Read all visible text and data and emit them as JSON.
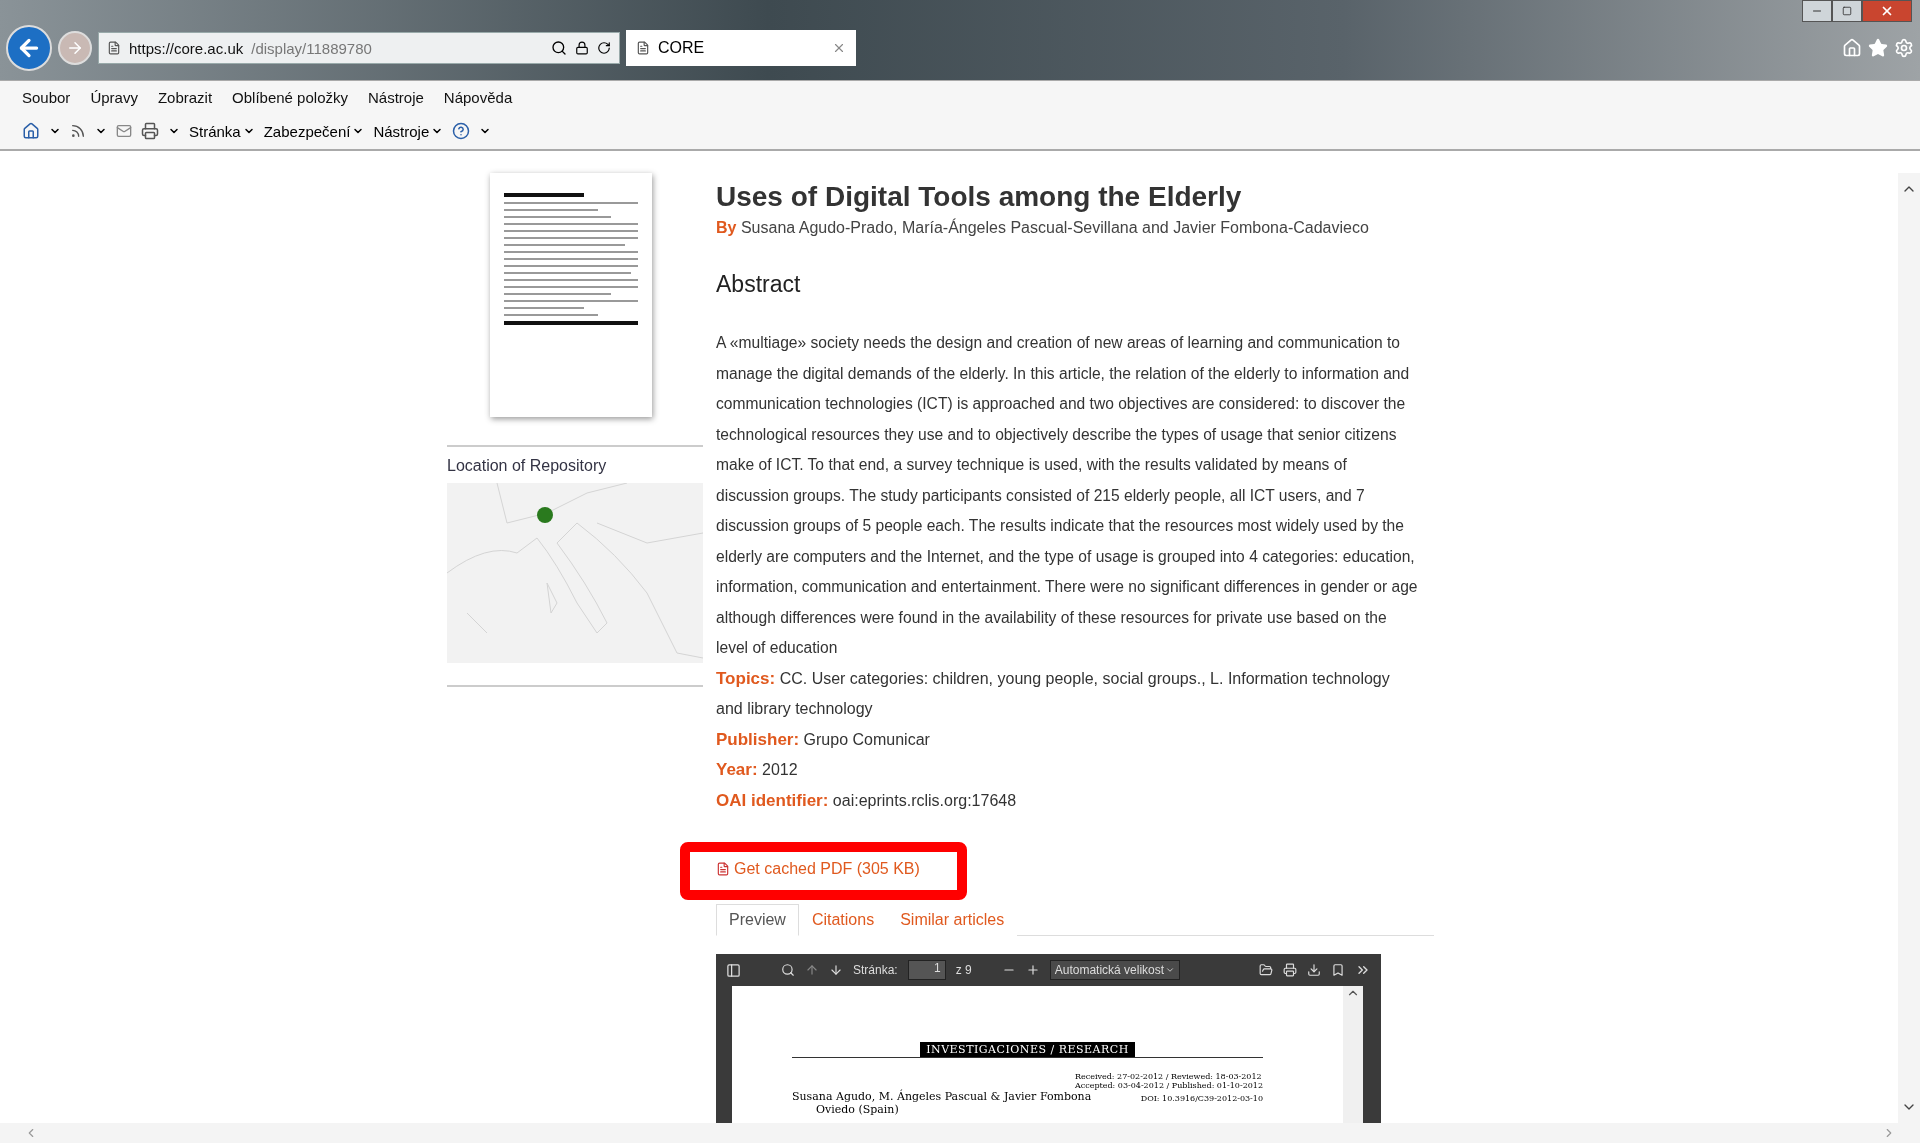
{
  "browser": {
    "address": {
      "host": "https://core.ac.uk",
      "path": "/display/11889780"
    },
    "tab": {
      "title": "CORE"
    },
    "menu": [
      "Soubor",
      "Úpravy",
      "Zobrazit",
      "Oblíbené položky",
      "Nástroje",
      "Nápověda"
    ],
    "toolbar": [
      "Stránka",
      "Zabezpečení",
      "Nástroje"
    ]
  },
  "sidebar": {
    "location_heading": "Location of Repository"
  },
  "article": {
    "title": "Uses of Digital Tools among the Elderly",
    "by_label": "By",
    "authors": "Susana Agudo-Prado, María-Ángeles Pascual-Sevillana and Javier Fombona-Cadavieco",
    "abstract_heading": "Abstract",
    "abstract": "A «multiage» society needs the design and creation of new areas of learning and communication to manage the digital demands of the elderly. In this article, the relation of the elderly to information and communication technologies (ICT) is approached and two objectives are considered: to discover the technological resources they use and to objectively describe the types of usage that senior citizens make of ICT. To that end, a survey technique is used, with the results validated by means of discussion groups. The study participants consisted of 215 elderly people, all ICT users, and 7 discussion groups of 5 people each. The results indicate that the resources most widely used by the elderly are computers and the Internet, and the type of usage is grouped into 4 categories: education, information, communication and entertainment. There were no significant differences in gender or age although differences were found in the availability of these resources for private use based on the level of education",
    "fields": [
      {
        "label": "Topics:",
        "value": "CC. User categories: children, young people, social groups., L. Information technology and library technology"
      },
      {
        "label": "Publisher:",
        "value": "Grupo Comunicar"
      },
      {
        "label": "Year:",
        "value": "2012"
      },
      {
        "label": "OAI identifier:",
        "value": "oai:eprints.rclis.org:17648"
      }
    ],
    "download": "Get cached PDF (305 KB)",
    "tabs": [
      {
        "label": "Preview",
        "selected": true
      },
      {
        "label": "Citations",
        "selected": false
      },
      {
        "label": "Similar articles",
        "selected": false
      }
    ]
  },
  "pdf_viewer": {
    "page_label": "Stránka:",
    "page": "1",
    "page_count": "z 9",
    "zoom": "Automatická velikost",
    "banner": "INVESTIGACIONES / RESEARCH",
    "dates": [
      "Received: 27-02-2012 / Reviewed: 18-03-2012",
      "Accepted: 03-04-2012 / Published: 01-10-2012"
    ],
    "authors": "Susana Agudo, M. Ángeles Pascual & Javier Fombona",
    "location": "Oviedo (Spain)",
    "doi": "DOI: 10.3916/C39-2012-03-10"
  }
}
